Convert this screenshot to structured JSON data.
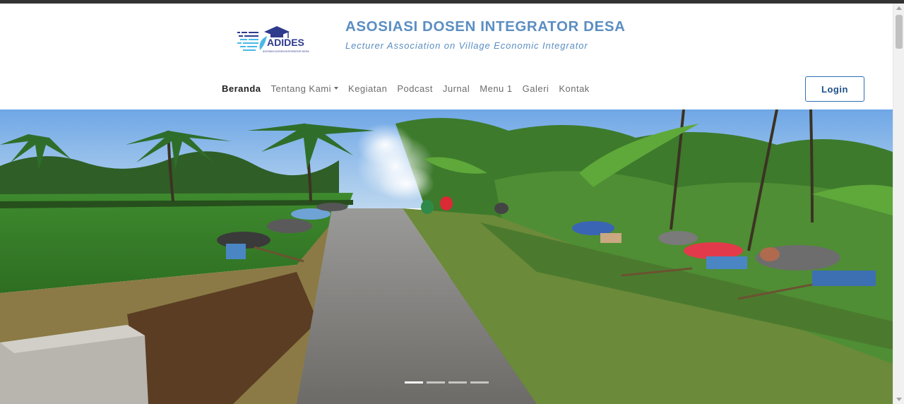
{
  "brand": {
    "logo_text": "ADIDES",
    "logo_tagline": "ASOSIASI DOSEN INTEGRATOR DESA",
    "title": "ASOSIASI DOSEN INTEGRATOR DESA",
    "subtitle": "Lecturer Association on Village Economic Integrator",
    "colors": {
      "primary": "#5b8ec2",
      "logo_dark": "#2e3a8c",
      "logo_light": "#4ab8e8"
    }
  },
  "nav": {
    "items": [
      {
        "label": "Beranda",
        "active": true
      },
      {
        "label": "Tentang Kami",
        "dropdown": true
      },
      {
        "label": "Kegiatan"
      },
      {
        "label": "Podcast"
      },
      {
        "label": "Jurnal"
      },
      {
        "label": "Menu 1"
      },
      {
        "label": "Galeri"
      },
      {
        "label": "Kontak"
      }
    ],
    "login_label": "Login",
    "login_color": "#2f6fb6"
  },
  "carousel": {
    "slide_count": 4,
    "active_index": 0
  }
}
